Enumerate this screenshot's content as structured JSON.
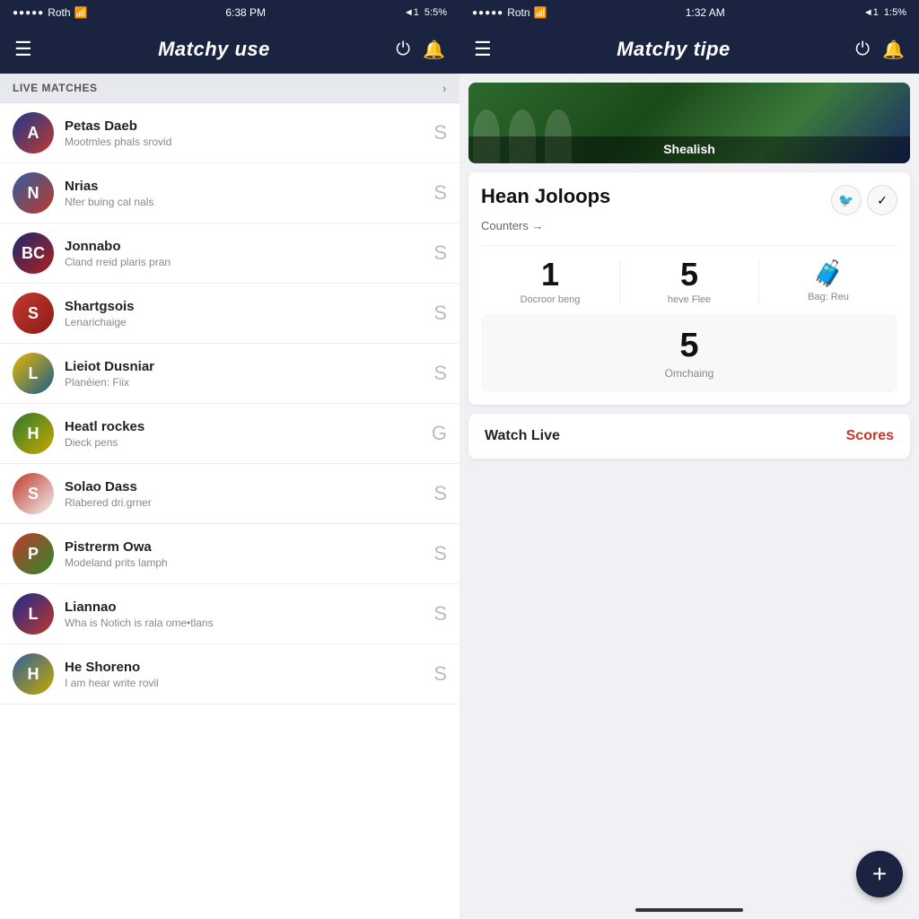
{
  "left": {
    "status": {
      "dots": "●●●●●",
      "carrier": "Roth",
      "wifi": "wifi",
      "time": "6:38 PM",
      "signal": "◄1",
      "battery": "5:5%"
    },
    "header": {
      "title": "Matchy use",
      "menu_icon": "☰",
      "power_icon": "⏻",
      "bell_icon": "🔔"
    },
    "section": {
      "label": "LIVE MATCHES",
      "chevron": "›"
    },
    "matches": [
      {
        "id": 1,
        "logo_class": "logo-1",
        "logo_text": "A",
        "name": "Petas Daeb",
        "sub": "Mootmles phals srovid",
        "score": "S"
      },
      {
        "id": 2,
        "logo_class": "logo-2",
        "logo_text": "N",
        "name": "Nrias",
        "sub": "Nfer buing cal nals",
        "score": "S"
      },
      {
        "id": 3,
        "logo_class": "logo-3",
        "logo_text": "BC",
        "name": "Jonnabo",
        "sub": "Cland rreid plaris pran",
        "score": "S"
      },
      {
        "id": 4,
        "logo_class": "logo-4",
        "logo_text": "S",
        "name": "Shartgsois",
        "sub": "Lenarichaige",
        "score": "S"
      },
      {
        "id": 5,
        "logo_class": "logo-5",
        "logo_text": "L",
        "name": "Lieiot Dusniar",
        "sub": "Planéien: Fiix",
        "score": "S"
      },
      {
        "id": 6,
        "logo_class": "logo-6",
        "logo_text": "H",
        "name": "Heatl rockes",
        "sub": "Dieck pens",
        "score": "G"
      },
      {
        "id": 7,
        "logo_class": "logo-7",
        "logo_text": "S",
        "name": "Solao Dass",
        "sub": "Rlabered dri.grner",
        "score": "S"
      },
      {
        "id": 8,
        "logo_class": "logo-8",
        "logo_text": "P",
        "name": "Pistrerm Owa",
        "sub": "Modeland prits lamph",
        "score": "S"
      },
      {
        "id": 9,
        "logo_class": "logo-9",
        "logo_text": "L",
        "name": "Liannao",
        "sub": "Wha is Notich is rala ome•tlans",
        "score": "S"
      },
      {
        "id": 10,
        "logo_class": "logo-10",
        "logo_text": "H",
        "name": "He Shoreno",
        "sub": "I am hear write rovil",
        "score": "S"
      }
    ]
  },
  "right": {
    "status": {
      "dots": "●●●●●",
      "carrier": "Rotn",
      "wifi": "wifi",
      "time": "1:32 AM",
      "signal": "◄1",
      "battery": "1:5%"
    },
    "header": {
      "title": "Matchy tipe",
      "menu_icon": "☰",
      "power_icon": "⏻",
      "bell_icon": "🔔"
    },
    "hero": {
      "label": "Shealish"
    },
    "detail": {
      "title": "Hean Joloops",
      "sub": "Counters →",
      "twitter_icon": "🐦",
      "check_icon": "✓",
      "stat1_value": "1",
      "stat1_label": "Docroor beng",
      "stat2_value": "5",
      "stat2_label": "heve Flee",
      "stat3_label": "Bag: Reu",
      "stat_sub_value": "5",
      "stat_sub_label": "Omchaing"
    },
    "watch_live": {
      "label": "Watch Live",
      "scores_label": "Scores"
    },
    "fab": {
      "icon": "+"
    }
  }
}
